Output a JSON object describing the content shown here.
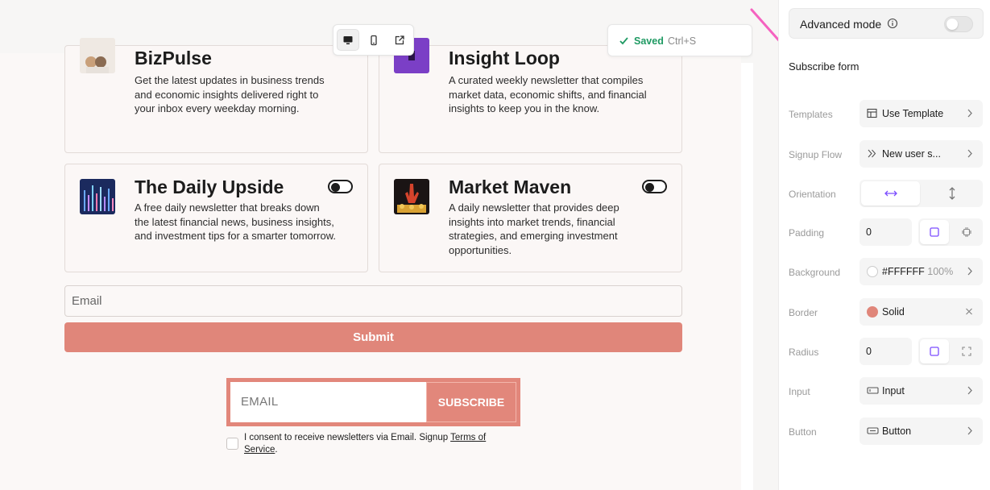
{
  "toolbar": {
    "saved_label": "Saved",
    "shortcut": "Ctrl+S"
  },
  "newsletters": [
    {
      "name": "BizPulse",
      "description": "Get the latest updates in business trends and economic insights delivered right to your inbox every weekday morning."
    },
    {
      "name": "Insight Loop",
      "description": "A curated weekly newsletter that compiles market data, economic shifts, and financial insights to keep you in the know."
    },
    {
      "name": "The Daily Upside",
      "description": "A free daily newsletter that breaks down the latest financial news, business insights, and investment tips for a smarter tomorrow."
    },
    {
      "name": "Market Maven",
      "description": "A daily newsletter that provides deep insights into market trends, financial strategies, and emerging investment opportunities."
    }
  ],
  "form": {
    "email_placeholder": "Email",
    "submit_label": "Submit"
  },
  "subscribe_form": {
    "email_placeholder": "EMAIL",
    "button_label": "SUBSCRIBE",
    "consent_text": "I consent to receive newsletters via Email. Signup",
    "consent_link": "Terms of Service",
    "consent_end": "."
  },
  "panel": {
    "advanced_mode_label": "Advanced mode",
    "title": "Subscribe form",
    "rows": {
      "templates": {
        "label": "Templates",
        "value": "Use Template"
      },
      "signup_flow": {
        "label": "Signup Flow",
        "value": "New user s..."
      },
      "orientation": {
        "label": "Orientation"
      },
      "padding": {
        "label": "Padding",
        "value": "0"
      },
      "background": {
        "label": "Background",
        "value": "#FFFFFF",
        "opacity": "100%"
      },
      "border": {
        "label": "Border",
        "value": "Solid"
      },
      "radius": {
        "label": "Radius",
        "value": "0"
      },
      "input": {
        "label": "Input",
        "value": "Input"
      },
      "button": {
        "label": "Button",
        "value": "Button"
      }
    }
  },
  "colors": {
    "accent": "#E0867A",
    "saved": "#1F9A63",
    "selection": "#7C4DFF",
    "arrow": "#F562C0"
  }
}
